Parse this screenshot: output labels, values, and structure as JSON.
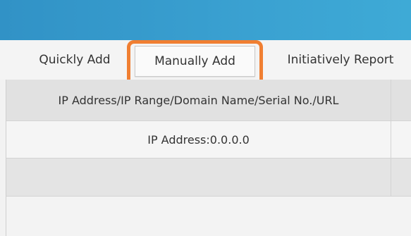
{
  "tabs": {
    "quick_label": "Quickly Add",
    "manual_label": "Manually Add",
    "report_label": "Initiatively Report"
  },
  "table": {
    "columns": [
      "IP Address/IP Range/Domain Name/Serial No./URL",
      ""
    ],
    "rows": [
      [
        "IP Address:0.0.0.0",
        ""
      ],
      [
        "",
        ""
      ]
    ]
  },
  "highlight_color": "#f07f32",
  "accent_color": "#3aa1d1"
}
